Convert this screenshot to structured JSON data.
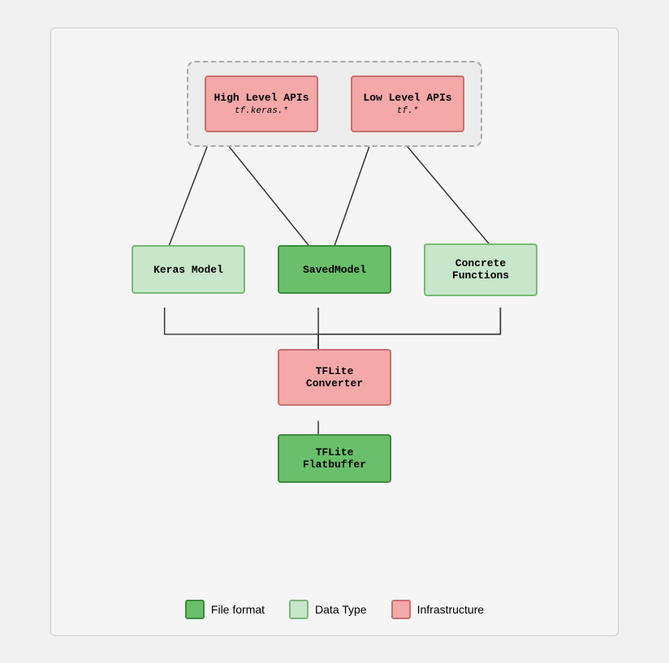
{
  "diagram": {
    "top_group": {
      "high_level": {
        "title": "High Level APIs",
        "subtitle": "tf.keras.*"
      },
      "low_level": {
        "title": "Low Level APIs",
        "subtitle": "tf.*"
      }
    },
    "mid_boxes": {
      "keras": "Keras Model",
      "saved": "SavedModel",
      "concrete": "Concrete\nFunctions"
    },
    "converter": "TFLite\nConverter",
    "flatbuffer": "TFLite\nFlatbuffer"
  },
  "legend": {
    "file_format": "File format",
    "data_type": "Data Type",
    "infrastructure": "Infrastructure"
  }
}
